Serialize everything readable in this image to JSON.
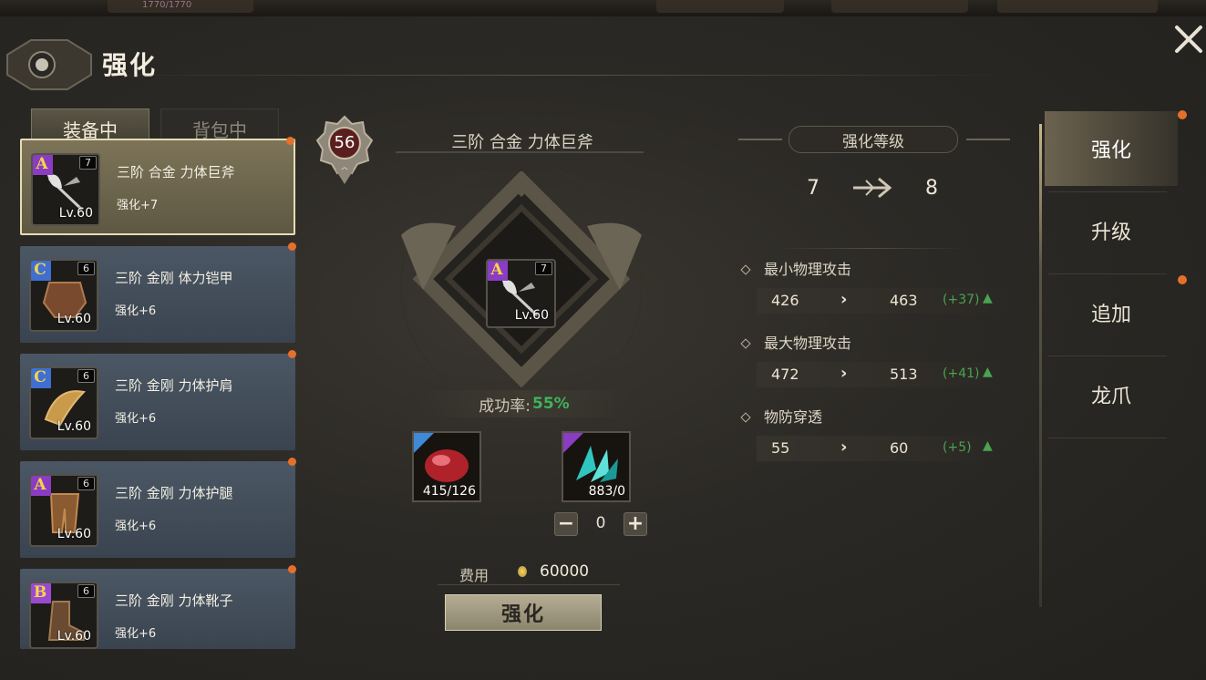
{
  "top_bar": {
    "hp_text": "1770/1770"
  },
  "header": {
    "title": "强化"
  },
  "tabs": [
    {
      "label": "装备中"
    },
    {
      "label": "背包中"
    }
  ],
  "equipment": [
    {
      "grade": "A",
      "stars": "7",
      "level": "Lv.60",
      "name": "三阶 合金 力体巨斧",
      "enhance": "强化+7"
    },
    {
      "grade": "C",
      "stars": "6",
      "level": "Lv.60",
      "name": "三阶 金刚 体力铠甲",
      "enhance": "强化+6"
    },
    {
      "grade": "C",
      "stars": "6",
      "level": "Lv.60",
      "name": "三阶 金刚 力体护肩",
      "enhance": "强化+6"
    },
    {
      "grade": "A",
      "stars": "6",
      "level": "Lv.60",
      "name": "三阶 金刚 力体护腿",
      "enhance": "强化+6"
    },
    {
      "grade": "B",
      "stars": "6",
      "level": "Lv.60",
      "name": "三阶 金刚 力体靴子",
      "enhance": "强化+6"
    }
  ],
  "center": {
    "badge_level": "56",
    "item_title": "三阶 合金 力体巨斧",
    "item_grade": "A",
    "item_stars": "7",
    "item_level": "Lv.60",
    "success_label": "成功率:",
    "success_value": "55%",
    "materials": [
      {
        "name": "red-ore",
        "qty": "415/126"
      },
      {
        "name": "cyan-crystal",
        "qty": "883/0"
      }
    ],
    "stepper_value": "0",
    "cost_label": "费用",
    "cost_value": "60000",
    "enhance_button": "强化"
  },
  "stats_panel": {
    "level_label": "强化等级",
    "level_from": "7",
    "level_to": "8",
    "stats": [
      {
        "name": "最小物理攻击",
        "from": "426",
        "to": "463",
        "delta": "(+37)"
      },
      {
        "name": "最大物理攻击",
        "from": "472",
        "to": "513",
        "delta": "(+41)"
      },
      {
        "name": "物防穿透",
        "from": "55",
        "to": "60",
        "delta": "(+5)"
      }
    ]
  },
  "side_menu": [
    {
      "label": "强化"
    },
    {
      "label": "升级"
    },
    {
      "label": "追加"
    },
    {
      "label": "龙爪"
    }
  ],
  "colors": {
    "accent_green": "#3fb35c",
    "notify_dot": "#e5702a",
    "grade_purple": "#8a3cc3"
  }
}
